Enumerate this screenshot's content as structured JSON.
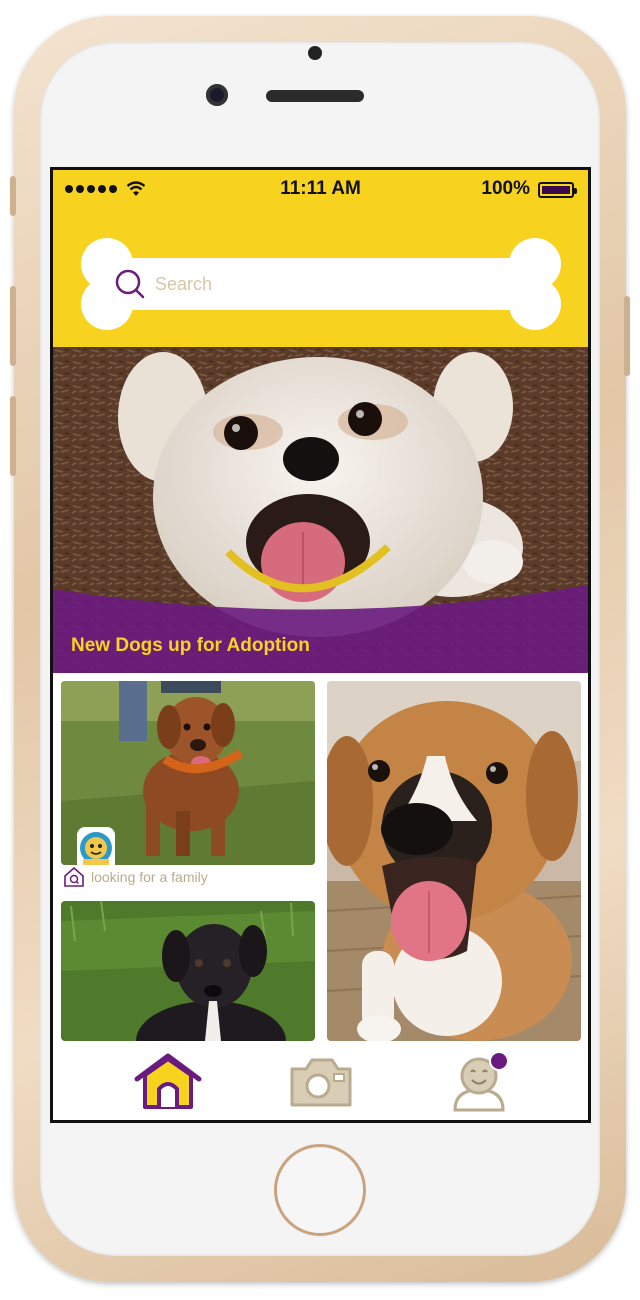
{
  "status_bar": {
    "time": "11:11 AM",
    "battery": "100%"
  },
  "search": {
    "placeholder": "Search"
  },
  "hero": {
    "title": "New Dogs up for Adoption"
  },
  "listing": {
    "caption": "looking for a family"
  },
  "tabs": [
    {
      "icon": "home-icon",
      "active": true
    },
    {
      "icon": "camera-icon",
      "active": false
    },
    {
      "icon": "profile-icon",
      "active": false,
      "notification": true
    }
  ],
  "colors": {
    "brand_yellow": "#f7d31f",
    "brand_purple": "#6a1b80",
    "muted_tan": "#c8bb9c"
  }
}
